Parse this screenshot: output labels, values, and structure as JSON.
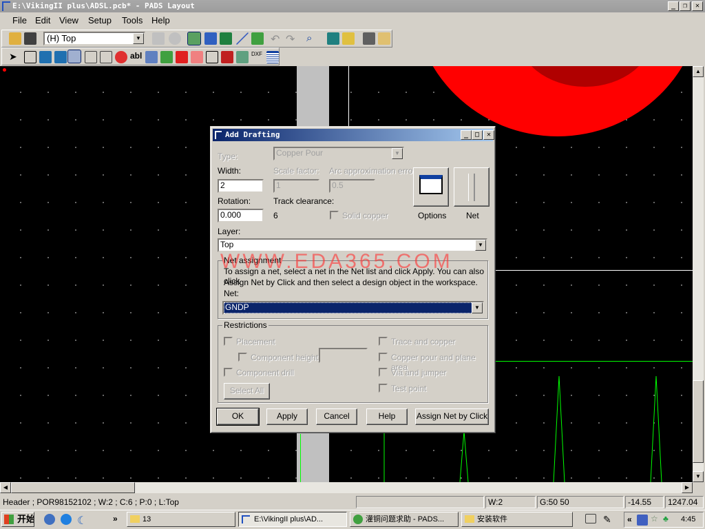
{
  "window": {
    "title": "E:\\VikingII plus\\ADSL.pcb* - PADS Layout"
  },
  "menu": [
    "File",
    "Edit",
    "View",
    "Setup",
    "Tools",
    "Help"
  ],
  "toolbar": {
    "layer_combo": "(H) Top"
  },
  "canvas": {
    "watermark": "WWW.EDA365.COM",
    "colors": {
      "pour": "#ff0000",
      "trace": "#00ff00",
      "bg": "#000000"
    }
  },
  "dialog": {
    "title": "Add Drafting",
    "type_label": "Type:",
    "type_value": "Copper Pour",
    "width_label": "Width:",
    "width_value": "2",
    "scale_label": "Scale factor:",
    "scale_value": "1",
    "arc_label": "Arc approximation error:",
    "arc_value": "0.5",
    "rotation_label": "Rotation:",
    "rotation_value": "0.000",
    "track_label": "Track clearance:",
    "track_value": "6",
    "solid_copper": "Solid copper",
    "options_label": "Options",
    "net_label": "Net",
    "layer_label": "Layer:",
    "layer_value": "Top",
    "net_group": "Net assignment",
    "net_help1": "To assign a net, select a net in the Net list and click Apply. You can also click",
    "net_help2": "Assign Net by Click and then select a design object in the workspace.",
    "net_label2": "Net:",
    "net_value": "GNDP",
    "restrictions": "Restrictions",
    "placement": "Placement",
    "component_height": "Component height",
    "component_drill": "Component drill",
    "select_all": "Select All",
    "trace_copper": "Trace and copper",
    "copper_pour_plane": "Copper pour and plane area",
    "via_jumper": "Via and jumper",
    "test_point": "Test point",
    "buttons": {
      "ok": "OK",
      "apply": "Apply",
      "cancel": "Cancel",
      "help": "Help",
      "assign": "Assign Net by Click"
    }
  },
  "status": {
    "info": "Header ; POR98152102 ; W:2 ; C:6 ; P:0 ; L:Top",
    "width": "W:2",
    "grid": "G:50 50",
    "x": "-14.55",
    "y": "1247.04"
  },
  "taskbar": {
    "start": "开始",
    "chevron": "»",
    "tasks": [
      "13",
      "E:\\VikingII plus\\AD...",
      "灌铜问题求助 - PADS...",
      "安装软件"
    ],
    "tray_chevron": "«",
    "clock": "4:45"
  }
}
